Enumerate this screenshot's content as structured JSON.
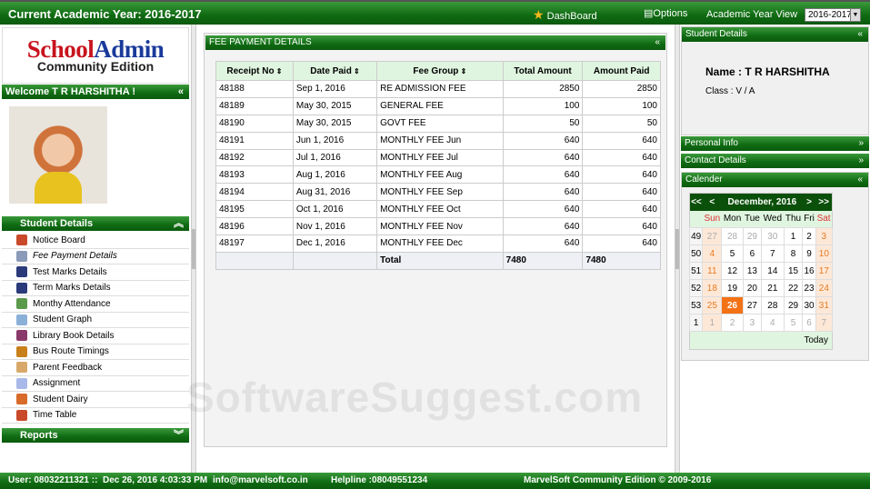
{
  "top": {
    "title": "Current Academic Year: 2016-2017",
    "dashboard": "DashBoard",
    "options": "Options",
    "year_view_label": "Academic Year View",
    "year_value": "2016-2017"
  },
  "logo": {
    "school": "School",
    "admin": "Admin",
    "edition": "Community Edition"
  },
  "welcome": "Welcome T R HARSHITHA !",
  "sidebar": {
    "header": "Student Details",
    "items": [
      {
        "label": "Notice Board",
        "color": "#c9492a"
      },
      {
        "label": "Fee Payment Details",
        "color": "#8a9ab8"
      },
      {
        "label": "Test Marks Details",
        "color": "#2a3a7a"
      },
      {
        "label": "Term Marks Details",
        "color": "#2a3a7a"
      },
      {
        "label": "Monthy Attendance",
        "color": "#5a9a4a"
      },
      {
        "label": "Student Graph",
        "color": "#8ab0d8"
      },
      {
        "label": "Library Book Details",
        "color": "#8a3a6a"
      },
      {
        "label": "Bus Route Timings",
        "color": "#c8801a"
      },
      {
        "label": "Parent Feedback",
        "color": "#d8a86a"
      },
      {
        "label": "Assignment",
        "color": "#a8b8e8"
      },
      {
        "label": "Student Dairy",
        "color": "#d86a2a"
      },
      {
        "label": "Time Table",
        "color": "#c9492a"
      }
    ],
    "reports": "Reports"
  },
  "fee": {
    "title": "FEE PAYMENT DETAILS",
    "columns": [
      "Receipt No",
      "Date Paid",
      "Fee Group",
      "Total Amount",
      "Amount Paid"
    ],
    "rows": [
      [
        "48188",
        "Sep 1, 2016",
        "RE ADMISSION FEE",
        "2850",
        "2850"
      ],
      [
        "48189",
        "May 30, 2015",
        "GENERAL FEE",
        "100",
        "100"
      ],
      [
        "48190",
        "May 30, 2015",
        "GOVT FEE",
        "50",
        "50"
      ],
      [
        "48191",
        "Jun 1, 2016",
        "MONTHLY FEE Jun",
        "640",
        "640"
      ],
      [
        "48192",
        "Jul 1, 2016",
        "MONTHLY FEE Jul",
        "640",
        "640"
      ],
      [
        "48193",
        "Aug 1, 2016",
        "MONTHLY FEE Aug",
        "640",
        "640"
      ],
      [
        "48194",
        "Aug 31, 2016",
        "MONTHLY FEE Sep",
        "640",
        "640"
      ],
      [
        "48195",
        "Oct 1, 2016",
        "MONTHLY FEE Oct",
        "640",
        "640"
      ],
      [
        "48196",
        "Nov 1, 2016",
        "MONTHLY FEE Nov",
        "640",
        "640"
      ],
      [
        "48197",
        "Dec 1, 2016",
        "MONTHLY FEE Dec",
        "640",
        "640"
      ]
    ],
    "total_label": "Total",
    "total_amount": "7480",
    "total_paid": "7480"
  },
  "student": {
    "header": "Student Details",
    "name": "Name : T R HARSHITHA",
    "class": "Class : V / A"
  },
  "panels": {
    "personal": "Personal Info",
    "contact": "Contact Details",
    "calendar": "Calender"
  },
  "calendar": {
    "month": "December, 2016",
    "prev_year": "<<",
    "prev": "<",
    "next": ">",
    "next_year": ">>",
    "days": [
      "Sun",
      "Mon",
      "Tue",
      "Wed",
      "Thu",
      "Fri",
      "Sat"
    ],
    "weeks": [
      [
        "49",
        "27",
        "28",
        "29",
        "30",
        "1",
        "2",
        "3"
      ],
      [
        "50",
        "4",
        "5",
        "6",
        "7",
        "8",
        "9",
        "10"
      ],
      [
        "51",
        "11",
        "12",
        "13",
        "14",
        "15",
        "16",
        "17"
      ],
      [
        "52",
        "18",
        "19",
        "20",
        "21",
        "22",
        "23",
        "24"
      ],
      [
        "53",
        "25",
        "26",
        "27",
        "28",
        "29",
        "30",
        "31"
      ],
      [
        "1",
        "1",
        "2",
        "3",
        "4",
        "5",
        "6",
        "7"
      ]
    ],
    "selected": "26",
    "today": "Today"
  },
  "footer": {
    "user": "User: 08032211321 ::",
    "datetime": "Dec 26, 2016 4:03:33 PM",
    "email": "info@marvelsoft.co.in",
    "helpline": "Helpline :08049551234",
    "copyright": "MarvelSoft Community Edition © 2009-2016"
  },
  "watermark": "SoftwareSuggest.com"
}
